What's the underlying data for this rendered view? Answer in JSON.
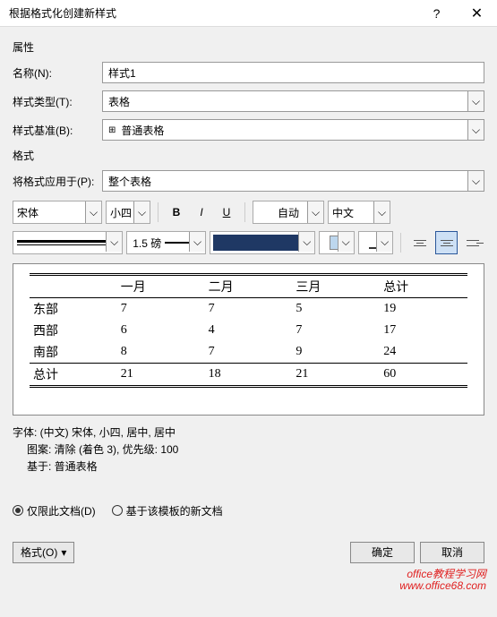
{
  "title": "根据格式化创建新样式",
  "sections": {
    "properties": "属性",
    "format": "格式"
  },
  "labels": {
    "name": "名称(N):",
    "styleType": "样式类型(T):",
    "styleBase": "样式基准(B):",
    "applyTo": "将格式应用于(P):"
  },
  "values": {
    "name": "样式1",
    "styleType": "表格",
    "styleBase": "普通表格",
    "applyTo": "整个表格",
    "font": "宋体",
    "size": "小四",
    "autoColor": "自动",
    "lang": "中文",
    "weight": "1.5 磅"
  },
  "chart_data": {
    "type": "table",
    "columns": [
      "",
      "一月",
      "二月",
      "三月",
      "总计"
    ],
    "rows": [
      [
        "东部",
        7,
        7,
        5,
        19
      ],
      [
        "西部",
        6,
        4,
        7,
        17
      ],
      [
        "南部",
        8,
        7,
        9,
        24
      ],
      [
        "总计",
        21,
        18,
        21,
        60
      ]
    ]
  },
  "desc": {
    "line1": "字体: (中文) 宋体, 小四, 居中, 居中",
    "line2": "图案: 清除 (着色 3), 优先级: 100",
    "line3": "基于: 普通表格"
  },
  "radios": {
    "thisDoc": "仅限此文档(D)",
    "template": "基于该模板的新文档"
  },
  "buttons": {
    "format": "格式(O)",
    "ok": "确定",
    "cancel": "取消"
  },
  "watermark": {
    "text": "office教程学习网",
    "url": "www.office68.com"
  }
}
